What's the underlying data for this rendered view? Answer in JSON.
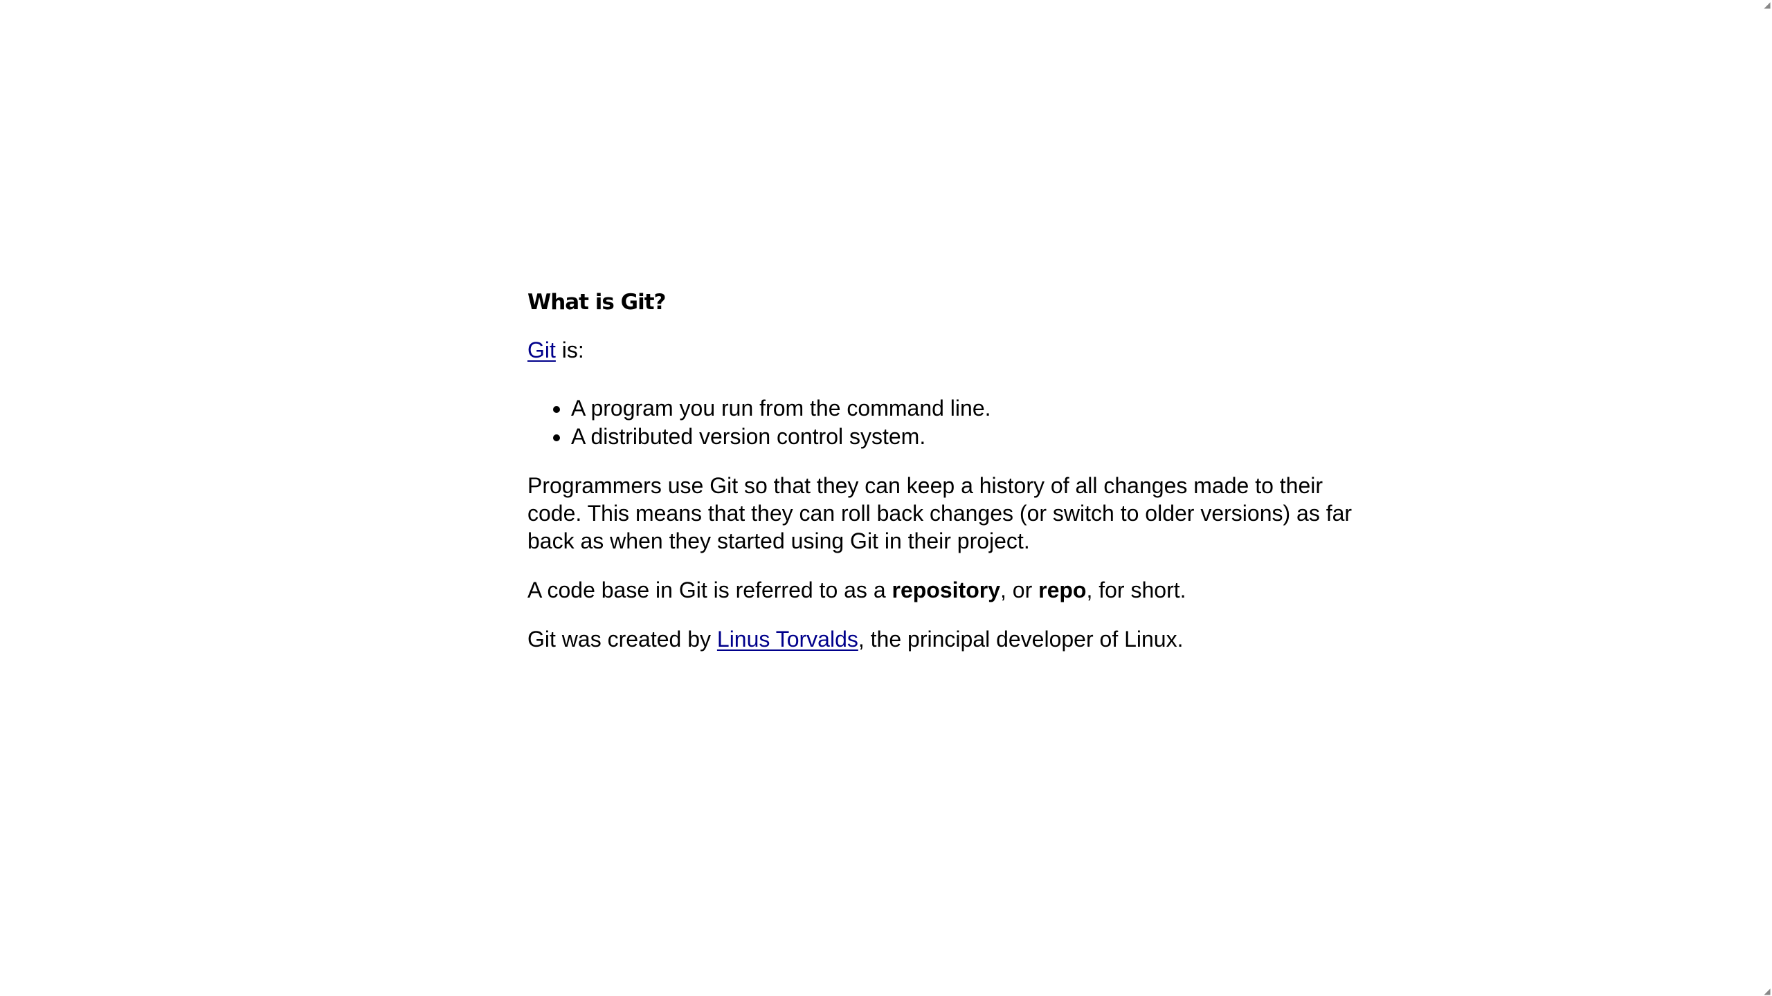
{
  "article": {
    "heading": "What is Git?",
    "intro": {
      "link_text": "Git",
      "suffix": " is:"
    },
    "list": [
      "A program you run from the command line.",
      "A distributed version control system."
    ],
    "paragraph1": "Programmers use Git so that they can keep a history of all changes made to their code. This means that they can roll back changes (or switch to older versions) as far back as when they started using Git in their project.",
    "paragraph2": {
      "part1": "A code base in Git is referred to as a ",
      "bold1": "repository",
      "part2": ", or ",
      "bold2": "repo",
      "part3": ", for short."
    },
    "paragraph3": {
      "part1": "Git was created by ",
      "link_text": "Linus Torvalds",
      "part2": ", the principal developer of Linux."
    }
  },
  "scrollbar": {
    "up_icon": "scroll-up-icon",
    "down_icon": "scroll-down-icon"
  }
}
